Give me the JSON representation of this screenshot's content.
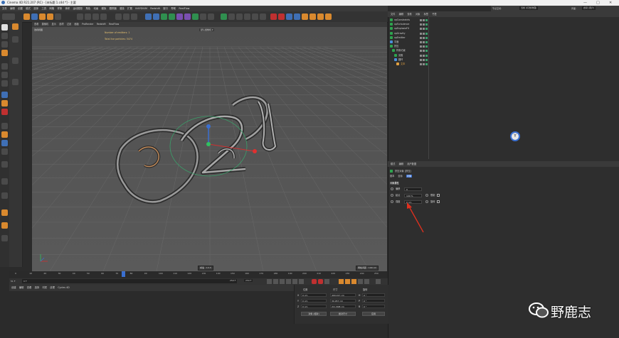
{
  "window": {
    "title": "Cinema 4D R21.207 (RC) - [未标题 1.c4d *] - 主要",
    "controls": [
      "—",
      "□",
      "✕"
    ]
  },
  "menu": {
    "items": [
      "文件",
      "编辑",
      "创建",
      "模式",
      "选择",
      "工具",
      "网格",
      "样条",
      "体积",
      "运动图形",
      "角色",
      "动画",
      "模拟",
      "跟踪器",
      "渲染",
      "扩展",
      "INSYDIUM",
      "Redshift",
      "窗口",
      "帮助",
      "RealFlow"
    ]
  },
  "topright": {
    "label1": "节点空间:",
    "value1": "当前 (标准/物理)",
    "label2": "界面:",
    "value2": "启动 (用户)"
  },
  "viewport": {
    "menu": [
      "查看",
      "摄像机",
      "显示",
      "选项",
      "过滤",
      "面板",
      "ProRender",
      "Redshift",
      "RealFlow"
    ],
    "label": "透视视图",
    "camera_dropdown": "默认摄像机 ▾",
    "hud_line1": "Number of emitters: 1",
    "hud_line2": "Total live particles: 5474",
    "speed_label": "帧速 : 13.3",
    "grid_label": "网格间距 : 100 cm"
  },
  "objects": {
    "tabs": [
      "文件",
      "编辑",
      "查看",
      "对象",
      "标签",
      "书签"
    ],
    "rows": [
      {
        "name": "xpConstraints",
        "color": "#2ea44f",
        "indent": 0
      },
      {
        "name": "xpTurbulence",
        "color": "#2ea44f",
        "indent": 0
      },
      {
        "name": "xpExplosiaFX",
        "color": "#2ea44f",
        "indent": 0
      },
      {
        "name": "xpGravity",
        "color": "#2ea44f",
        "indent": 0
      },
      {
        "name": "xpEmitter",
        "color": "#2ea44f",
        "indent": 0
      },
      {
        "name": "平面",
        "color": "#4a90d9",
        "indent": 0
      },
      {
        "name": "挤压",
        "color": "#2ea44f",
        "indent": 0
      },
      {
        "name": "样条约束",
        "color": "#2ea44f",
        "indent": 1
      },
      {
        "name": "克隆",
        "color": "#2ea44f",
        "indent": 2
      },
      {
        "name": "圆环",
        "color": "#4a90d9",
        "indent": 2
      },
      {
        "name": "文本",
        "color": "#e0a040",
        "indent": 3
      }
    ]
  },
  "attributes": {
    "tabs": [
      "模式",
      "编辑",
      "用户数据"
    ],
    "object_label": "挤压对象 [挤压]",
    "subtabs": [
      "基本",
      "坐标",
      "对象"
    ],
    "section": "对象属性",
    "fields": [
      {
        "label": "偏移",
        "value": "0"
      },
      {
        "label": "起点",
        "value": "100 %",
        "checkbox": "限制"
      },
      {
        "label": "强度",
        "value": "0 cm",
        "checkbox": "旋转"
      }
    ]
  },
  "timeline": {
    "ticks": [
      "0",
      "10",
      "20",
      "30",
      "40",
      "50",
      "60",
      "70",
      "80",
      "90",
      "100",
      "110",
      "120",
      "130",
      "140",
      "150",
      "160",
      "170",
      "180",
      "190",
      "200",
      "210",
      "220",
      "230",
      "240",
      "250"
    ],
    "current_frame": "51 F",
    "start": "0 F",
    "start2": "0 F",
    "end": "250 F",
    "end2": "250 F"
  },
  "materials": {
    "menu": [
      "创建",
      "编辑",
      "查看",
      "选择",
      "材质",
      "纹理",
      "Cycles 4D"
    ]
  },
  "coordinates": {
    "headers": [
      "位置",
      "尺寸",
      "旋转"
    ],
    "rows": [
      {
        "axis": "X",
        "pos": "0 cm",
        "size": "400.017 cm",
        "rlabel": "H",
        "rot": "0 °"
      },
      {
        "axis": "Y",
        "pos": "0 cm",
        "size": "30.057 cm",
        "rlabel": "P",
        "rot": "0 °"
      },
      {
        "axis": "Z",
        "pos": "0 cm",
        "size": "211.808 cm",
        "rlabel": "B",
        "rot": "0 °"
      }
    ],
    "mode1": "对象 (相对)",
    "mode2": "绝对尺寸",
    "apply": "应用"
  },
  "watermark": {
    "text": "野鹿志"
  },
  "colors": {
    "annotation_arrow": "#e0301e",
    "hud_text": "#e6c170",
    "accent_blue": "#4a90d9"
  }
}
